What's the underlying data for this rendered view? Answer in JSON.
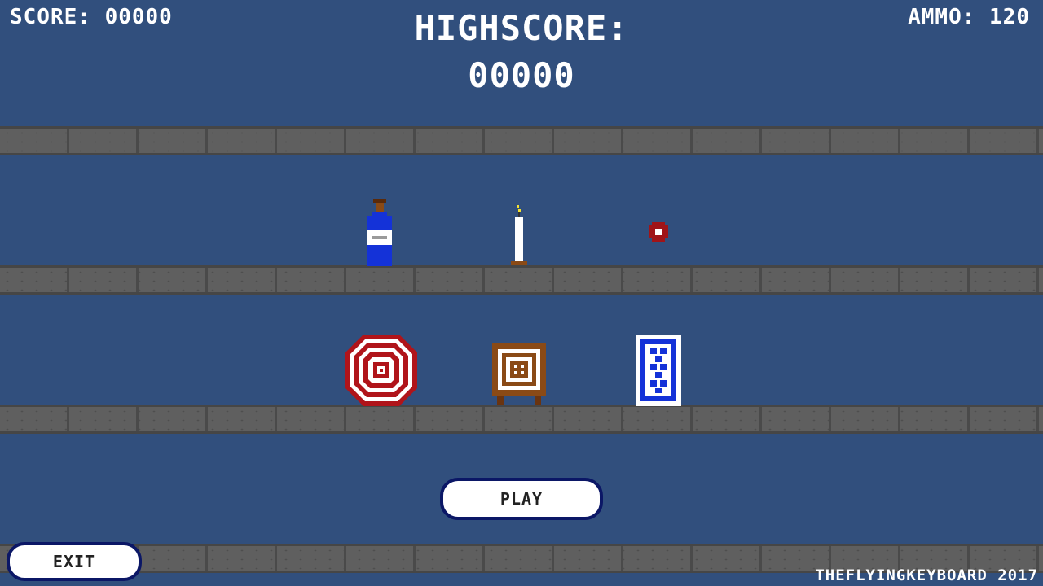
{
  "hud": {
    "score": "SCORE: 00000",
    "ammo": "AMMO: 120",
    "highscore_label": "HIGHSCORE:",
    "highscore_value": "00000"
  },
  "buttons": {
    "play": "PLAY",
    "exit": "EXIT"
  },
  "footer": {
    "credit": "THEFLYINGKEYBOARD 2017"
  },
  "targets": {
    "top_shelf": [
      "bottle",
      "candle",
      "ring"
    ],
    "middle_shelf": [
      "bullseye",
      "crate",
      "card"
    ]
  },
  "colors": {
    "background": "#314f7d",
    "shelf": "#5f5f5f",
    "button_border": "#0b1766",
    "bullseye_red": "#b0141a",
    "bottle_blue": "#1432d8",
    "crate_brown": "#8a4a16"
  }
}
